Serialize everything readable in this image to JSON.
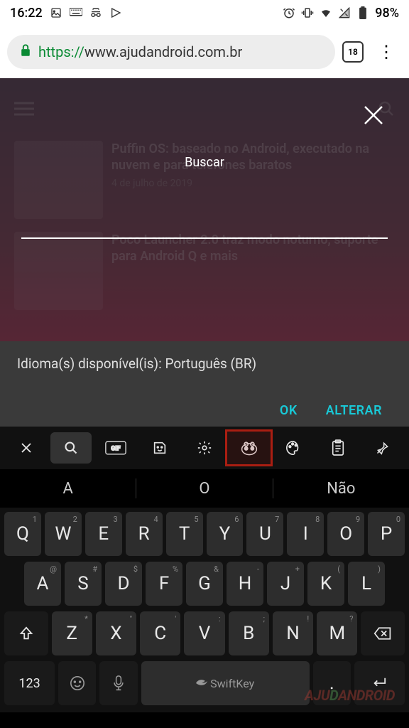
{
  "status": {
    "time": "16:22",
    "battery": "98%"
  },
  "browser": {
    "url_scheme": "https://",
    "url_host": "www.ajudandroid.com.br",
    "tab_count": "18"
  },
  "bg": {
    "article1_title": "Puffin OS: baseado no Android, executado na nuvem e para telefones baratos",
    "article1_date": "4 de julho de 2019",
    "article2_title": "Poco Launcher 2.0 traz modo noturno, suporte para Android Q e mais"
  },
  "search": {
    "label": "Buscar",
    "value": ""
  },
  "snackbar": {
    "text": "Idioma(s) disponível(is): Português (BR)",
    "ok": "OK",
    "alter": "ALTERAR"
  },
  "suggestions": {
    "a": "A",
    "b": "O",
    "c": "Não"
  },
  "keys": {
    "row1": [
      "Q",
      "W",
      "E",
      "R",
      "T",
      "Y",
      "U",
      "I",
      "O",
      "P"
    ],
    "row1_alt": [
      "1",
      "2",
      "3",
      "4",
      "5",
      "6",
      "7",
      "8",
      "9",
      "0"
    ],
    "row2": [
      "A",
      "S",
      "D",
      "F",
      "G",
      "H",
      "J",
      "K",
      "L"
    ],
    "row2_alt": [
      "@",
      "#",
      "$",
      "%",
      "&",
      "-",
      "+",
      "(",
      ")"
    ],
    "row3": [
      "Z",
      "X",
      "C",
      "V",
      "B",
      "N",
      "M"
    ],
    "row3_alt": [
      "*",
      "\"",
      "'",
      ":",
      ";",
      "!",
      "?"
    ],
    "k123": "123",
    "swiftkey": "SwiftKey",
    "dot": "."
  },
  "watermark": "AJUDANDROID"
}
